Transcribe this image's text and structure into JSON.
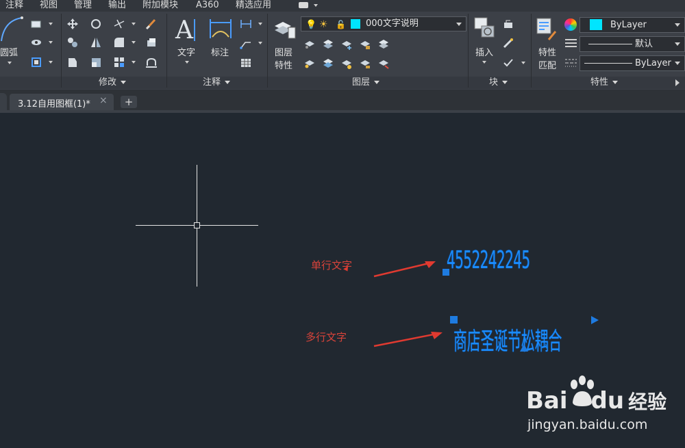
{
  "menu": {
    "items": [
      "注释",
      "视图",
      "管理",
      "输出",
      "附加模块",
      "A360",
      "精选应用"
    ]
  },
  "ribbon": {
    "draw": {
      "arc_label": "圆弧"
    },
    "modify": {
      "title": "修改"
    },
    "annotation": {
      "title": "注释",
      "text_label": "文字",
      "dimension_label": "标注"
    },
    "layers": {
      "title": "图层",
      "properties_label_1": "图层",
      "properties_label_2": "特性",
      "current_layer": "000文字说明",
      "layer_color": "#00e5ff"
    },
    "block": {
      "title": "块",
      "insert_label": "插入"
    },
    "properties": {
      "title": "特性",
      "match_label_1": "特性",
      "match_label_2": "匹配",
      "color_value": "ByLayer",
      "color_swatch": "#00e5ff",
      "lineweight_value": "默认",
      "linetype_value": "ByLayer"
    }
  },
  "tabs": {
    "document_tab": "3.12自用图框(1)*",
    "close_glyph": "×",
    "new_tab_glyph": "+"
  },
  "canvas": {
    "single_line_label": "单行文字",
    "multi_line_label": "多行文字",
    "single_line_text": "4552242245",
    "multi_line_text": "商店圣诞节松耦合",
    "text_color": "#1a8cff",
    "annotation_color": "#d8433a"
  },
  "watermark": {
    "brand": "Bai",
    "brand_suffix": "du",
    "brand_cn": "经验",
    "url": "jingyan.baidu.com"
  }
}
